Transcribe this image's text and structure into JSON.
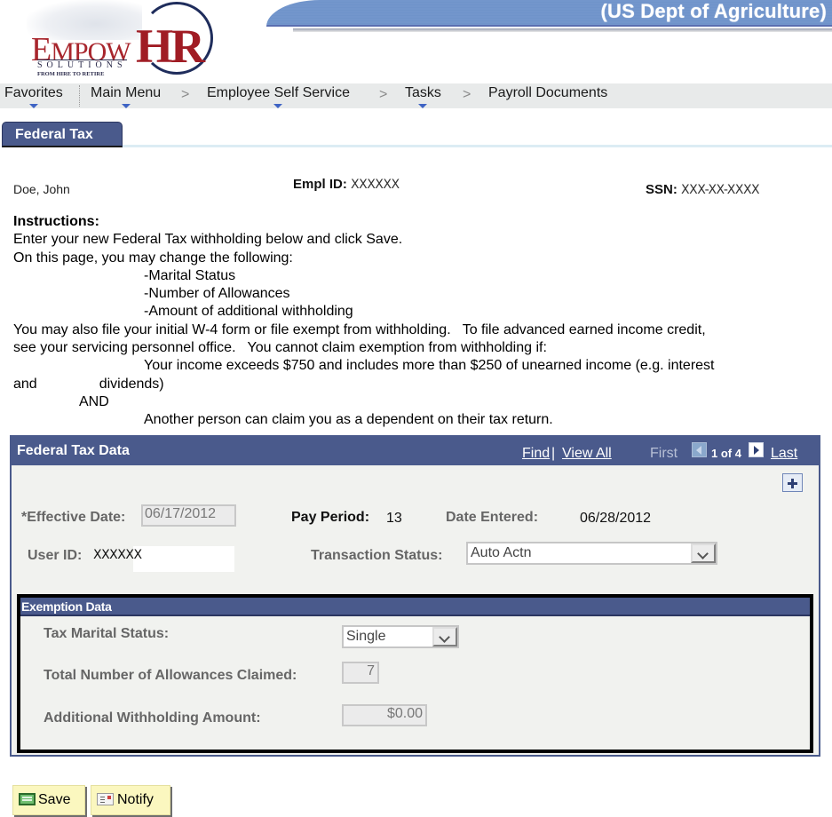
{
  "header": {
    "agency": "(US Dept of Agriculture)",
    "logo": {
      "name_part1": "Empow",
      "name_part2": "HR",
      "subtitle": "SOLUTIONS",
      "tagline": "FROM HIRE TO RETIRE"
    }
  },
  "nav": {
    "items": [
      {
        "label": "Favorites",
        "has_dropdown": true
      },
      {
        "label": "Main Menu",
        "has_dropdown": true
      },
      {
        "label": "Employee Self Service",
        "has_dropdown": true
      },
      {
        "label": "Tasks",
        "has_dropdown": true
      },
      {
        "label": "Payroll Documents",
        "has_dropdown": false
      }
    ],
    "separator": ">"
  },
  "tab": {
    "label": "Federal Tax"
  },
  "employee": {
    "name": "Doe, John",
    "empl_id_label": "Empl ID:",
    "empl_id": "XXXXXX",
    "ssn_label": "SSN:",
    "ssn": "XXX-XX-XXXX"
  },
  "instructions": {
    "heading": "Instructions:",
    "line1": "Enter your new Federal Tax withholding below and click Save.",
    "line2": "On this page, you may change the following:",
    "item1": "-Marital Status",
    "item2": "-Number of Allowances",
    "item3": "-Amount of additional withholding",
    "line3": "You may also file your initial W-4 form or file exempt from withholding.   To file advanced earned income credit,",
    "line4": "see your servicing personnel office.   You cannot claim exemption from withholding if:",
    "cond1a": "Your income exceeds $750 and includes more than $250 of unearned income (e.g. interest",
    "cond1b_pre": "and",
    "cond1b_post": "dividends)",
    "and": "AND",
    "cond2": "Another person can claim you as a dependent on their tax return."
  },
  "panel": {
    "title": "Federal Tax Data",
    "find": "Find",
    "pipe": "|",
    "view_all": "View All",
    "first": "First",
    "count": "1 of 4",
    "last": "Last",
    "fields": {
      "effective_date_label": "*Effective Date:",
      "effective_date": "06/17/2012",
      "pay_period_label": "Pay Period:",
      "pay_period": "13",
      "date_entered_label": "Date Entered:",
      "date_entered": "06/28/2012",
      "user_id_label": "User ID:",
      "user_id": "XXXXXX",
      "transaction_status_label": "Transaction Status:",
      "transaction_status": "Auto Actn"
    },
    "exemption": {
      "title": "Exemption Data",
      "marital_status_label": "Tax Marital Status:",
      "marital_status": "Single",
      "allowances_label": "Total Number of Allowances Claimed:",
      "allowances": "7",
      "additional_label": "Additional Withholding Amount:",
      "additional": "$0.00"
    }
  },
  "buttons": {
    "save": "Save",
    "notify": "Notify"
  }
}
